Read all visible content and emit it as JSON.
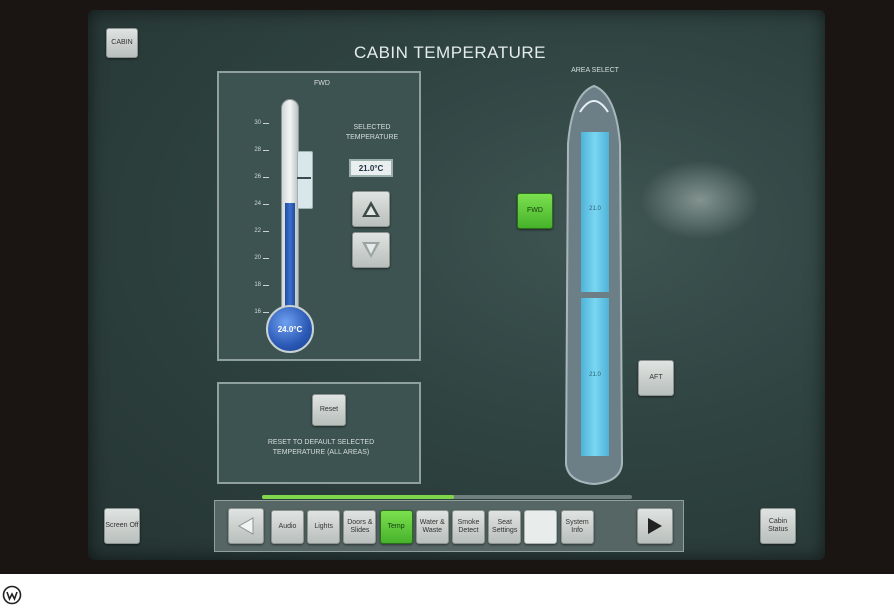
{
  "screen": {
    "title": "CABIN TEMPERATURE",
    "cabin_button": "CABIN",
    "screen_off_button": "Screen Off",
    "cabin_status_button": "Cabin Status"
  },
  "zone_panel": {
    "zone_label": "FWD",
    "current_temp": "24.0°C",
    "selected_label": "SELECTED TEMPERATURE",
    "selected_value": "21.0°C",
    "scale_ticks": [
      "30",
      "28",
      "26",
      "24",
      "22",
      "20",
      "18",
      "16"
    ]
  },
  "reset_panel": {
    "button_label": "Reset",
    "description": "RESET TO DEFAULT SELECTED TEMPERATURE (ALL AREAS)"
  },
  "area_select": {
    "label": "AREA SELECT",
    "fwd_button": "FWD",
    "aft_button": "AFT",
    "fwd_temp": "21.0",
    "aft_temp": "21.0"
  },
  "nav": {
    "items": [
      "Audio",
      "Lights",
      "Doors & Slides",
      "Temp",
      "Water & Waste",
      "Smoke Detect",
      "Seat Settings",
      "",
      "System Info"
    ],
    "active_index": 3,
    "progress_fraction": 0.52
  },
  "colors": {
    "active_green": "#5fcb3a",
    "thermo_blue": "#2f5fb8",
    "cabin_cyan": "#5cc4e6"
  },
  "icons": [
    "arrow-left-icon",
    "arrow-right-icon",
    "triangle-up-icon",
    "triangle-down-icon",
    "wikimedia-logo-icon"
  ]
}
